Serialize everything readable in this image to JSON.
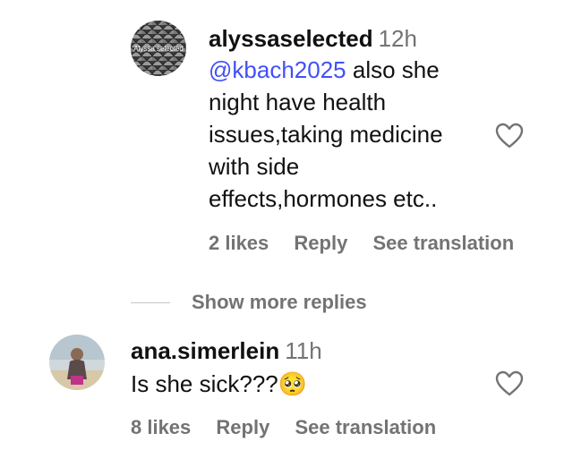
{
  "reply": {
    "username": "alyssaselected",
    "time": "12h",
    "mention": "@kbach2025",
    "text_lines": [
      "also she",
      "night have health",
      "issues,taking medicine",
      "with side",
      "effects,hormones etc.."
    ],
    "likes": "2 likes",
    "reply_label": "Reply",
    "translate_label": "See translation",
    "avatar_text": "Alyssa selected"
  },
  "show_more": "Show more replies",
  "comment": {
    "username": "ana.simerlein",
    "time": "11h",
    "text": "Is she sick???🥺",
    "likes": "8 likes",
    "reply_label": "Reply",
    "translate_label": "See translation"
  },
  "colors": {
    "mention": "#4150f7",
    "muted": "#737373",
    "text": "#111111"
  }
}
